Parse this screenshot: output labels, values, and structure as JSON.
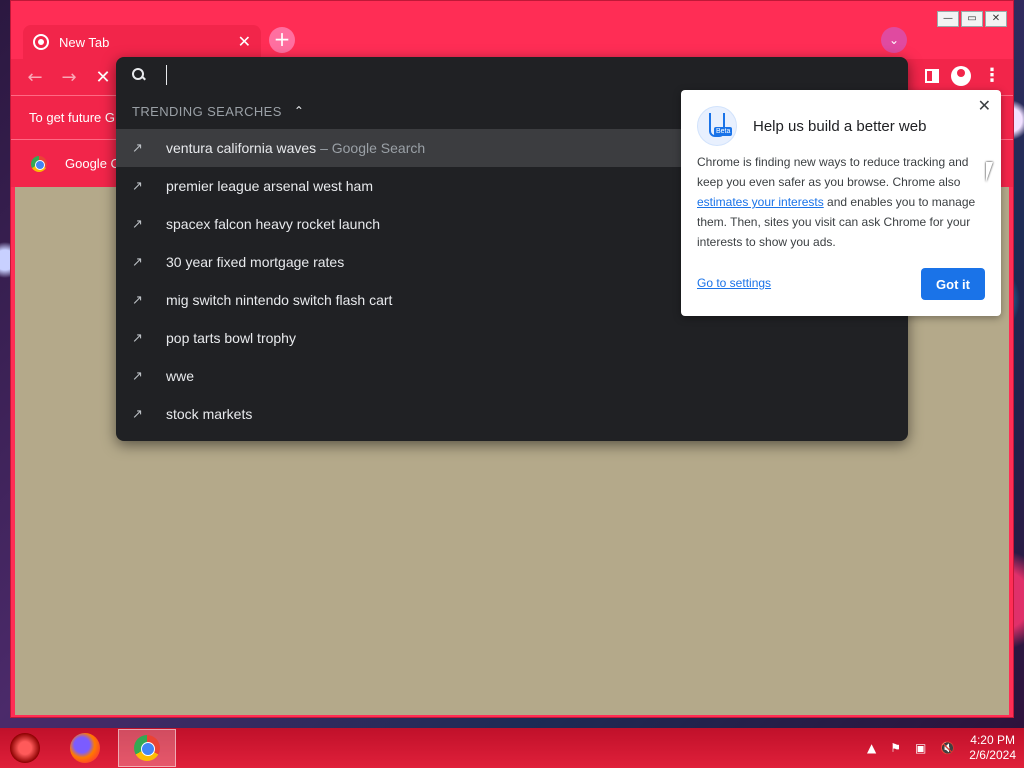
{
  "window": {
    "controls": {
      "minimize": "—",
      "restore": "▭",
      "close": "✕"
    }
  },
  "tab": {
    "title": "New Tab",
    "close": "✕"
  },
  "new_tab_label": "+",
  "tab_search_label": "⌄",
  "toolbar": {
    "back": "←",
    "forward": "→",
    "stop": "✕",
    "menu": "⋮"
  },
  "infobar": {
    "text": "To get future G"
  },
  "bookmarks": {
    "items": [
      {
        "label": "Google C"
      }
    ]
  },
  "omnibox": {
    "value": "",
    "section_header": "TRENDING SEARCHES",
    "section_caret": "⌃",
    "suggestions": [
      {
        "text": "ventura california waves",
        "suffix": "– Google Search",
        "selected": true
      },
      {
        "text": "premier league arsenal west ham",
        "suffix": ""
      },
      {
        "text": "spacex falcon heavy rocket launch",
        "suffix": ""
      },
      {
        "text": "30 year fixed mortgage rates",
        "suffix": ""
      },
      {
        "text": "mig switch nintendo switch flash cart",
        "suffix": ""
      },
      {
        "text": "pop tarts bowl trophy",
        "suffix": ""
      },
      {
        "text": "wwe",
        "suffix": ""
      },
      {
        "text": "stock markets",
        "suffix": ""
      }
    ],
    "trend_icon": "↗"
  },
  "bubble": {
    "close": "✕",
    "beta_label": "Beta",
    "title": "Help us build a better web",
    "body_part1": "Chrome is finding new ways to reduce tracking and keep you even safer as you browse. Chrome also ",
    "body_link": "estimates your interests",
    "body_part2": " and enables you to manage them. Then, sites you visit can ask Chrome for your interests to show you ads.",
    "settings_link": "Go to settings",
    "got_it": "Got it"
  },
  "taskbar": {
    "tray": {
      "caret": "▲",
      "flag": "⚑",
      "network": "▣",
      "volume": "🔇"
    },
    "time": "4:20 PM",
    "date": "2/6/2024"
  },
  "colors": {
    "chrome_frame": "#f2254a",
    "omnibox_bg": "#202124",
    "content_bg": "#b4a98a",
    "accent_blue": "#1a73e8"
  }
}
